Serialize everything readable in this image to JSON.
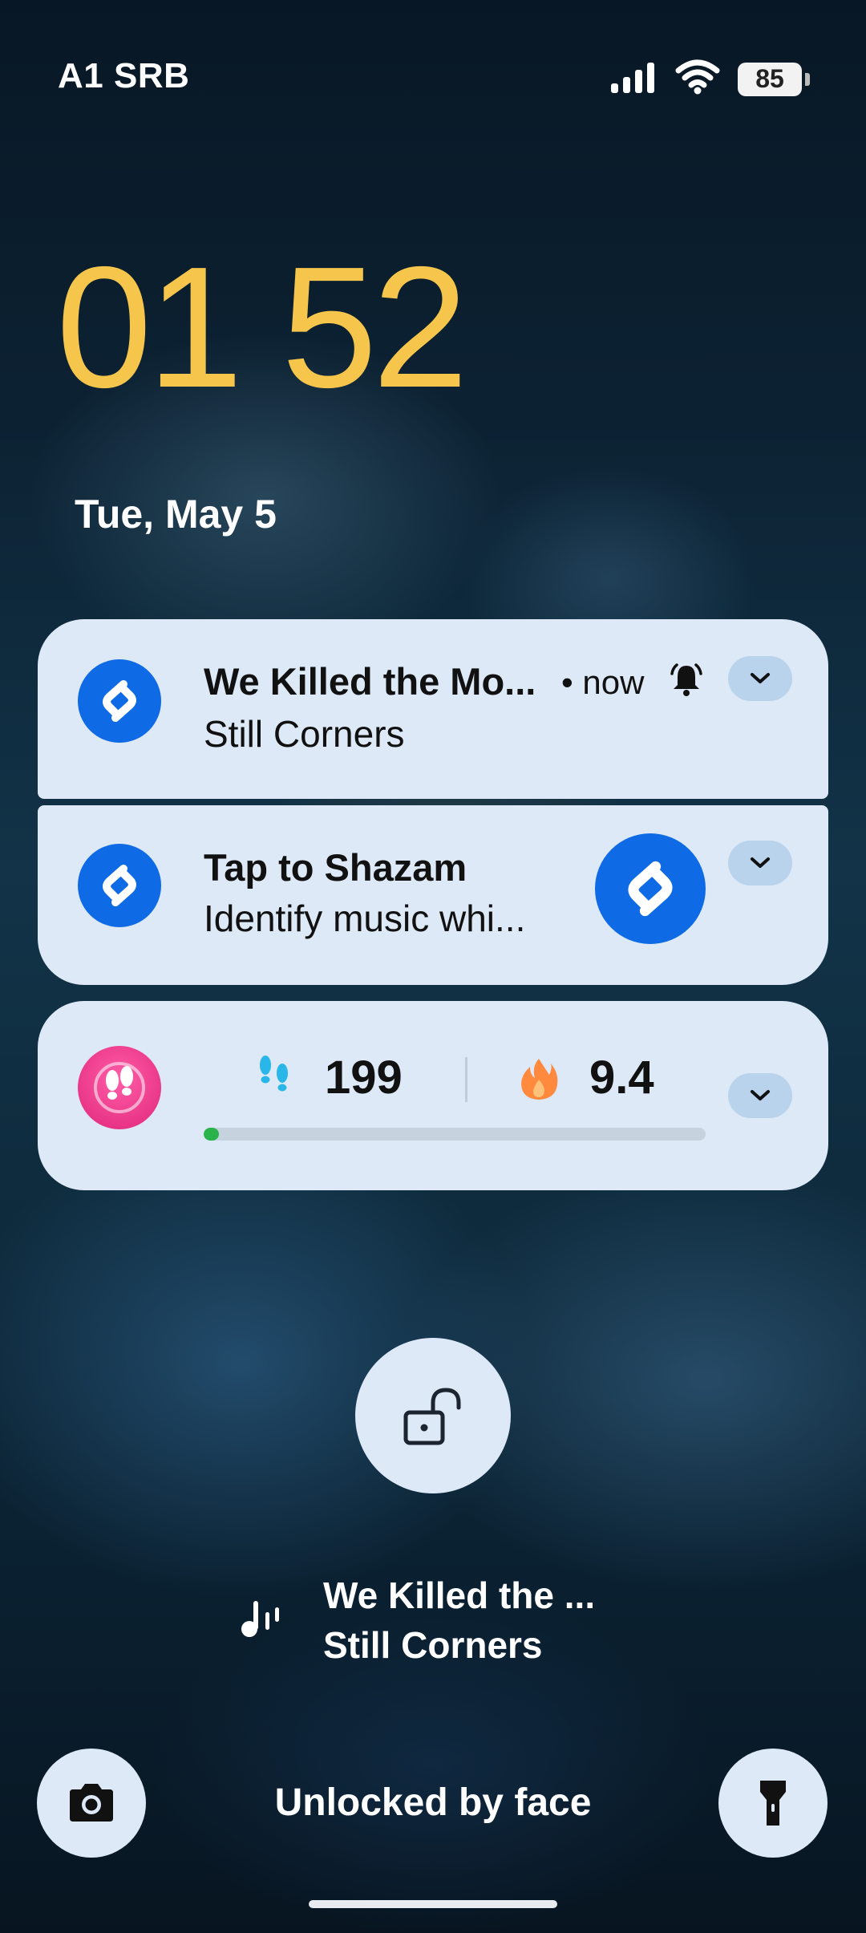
{
  "status_bar": {
    "carrier": "A1 SRB",
    "battery": "85",
    "icons": [
      "signal-icon",
      "wifi-icon",
      "battery-icon"
    ]
  },
  "lockscreen": {
    "time": "01 52",
    "date": "Tue, May 5"
  },
  "notifications": [
    {
      "app_icon": "shazam-icon",
      "title": "We Killed the Mo...",
      "time": "• now",
      "subtitle": "Still Corners",
      "bell_icon": "bell-ringing-icon"
    },
    {
      "app_icon": "shazam-icon",
      "title": "Tap to Shazam",
      "subtitle": "Identify music whi...",
      "action_icon": "shazam-button-icon"
    },
    {
      "app_icon": "footsteps-app-icon",
      "steps": "199",
      "calories": "9.4",
      "progress": 0.03,
      "steps_icon": "footsteps-icon",
      "calories_icon": "flame-icon"
    }
  ],
  "now_playing": {
    "title": "We Killed the ...",
    "artist": "Still Corners",
    "icon": "music-note-icon"
  },
  "bottom": {
    "unlock_status": "Unlocked by face",
    "left_icon": "camera-icon",
    "right_icon": "flashlight-icon"
  },
  "colors": {
    "clock": "#f6c64c",
    "card": "#dde9f7",
    "shazam_blue": "#0f6ae6",
    "progress": "#29b34a"
  }
}
